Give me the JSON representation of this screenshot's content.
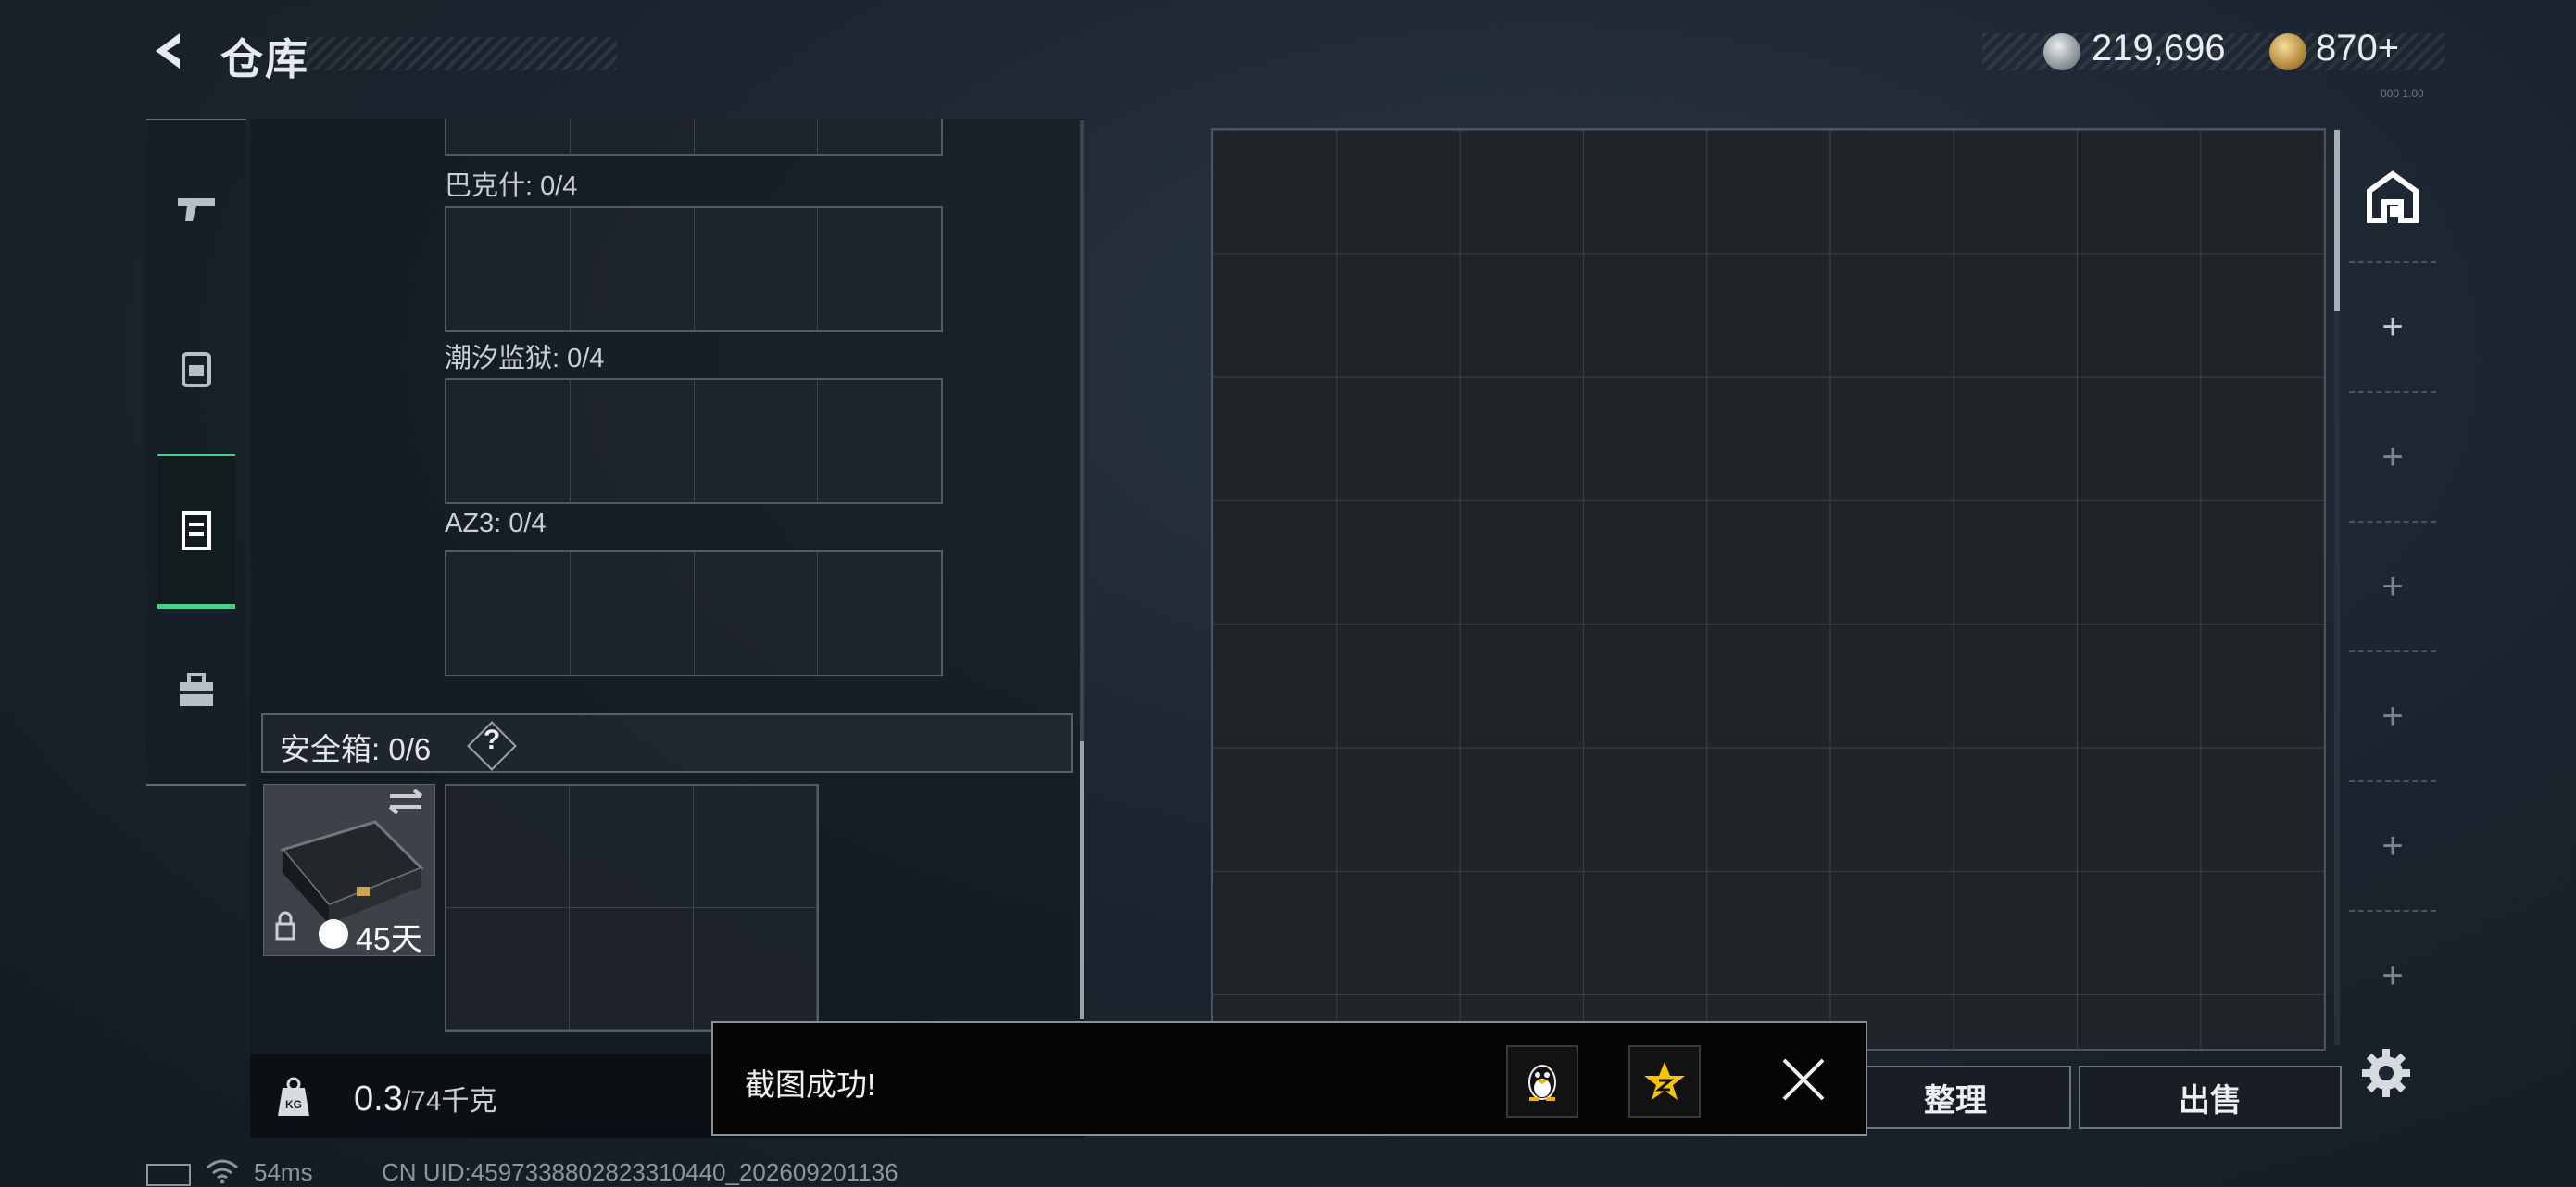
{
  "header": {
    "title": "仓库",
    "currency_silver": "219,696",
    "currency_gold": "870+",
    "tiny_label": "000 1.00"
  },
  "storage": {
    "slots": [
      {
        "label": "巴克什: 0/4"
      },
      {
        "label": "潮汐监狱: 0/4"
      },
      {
        "label": "AZ3: 0/4"
      }
    ],
    "safe_box": {
      "label": "安全箱: 0/6",
      "help": "?",
      "duration": "45天"
    },
    "weight": {
      "current": "0.3",
      "max": "/74千克"
    }
  },
  "buttons": {
    "sort": "整理",
    "sell": "出售"
  },
  "toast": {
    "message": "截图成功!"
  },
  "status": {
    "ping": "54ms",
    "uid": "CN UID:4597338802823310440_202609201136"
  },
  "right_tabs": [
    "first",
    "+",
    "+",
    "+",
    "+",
    "+",
    "+"
  ]
}
